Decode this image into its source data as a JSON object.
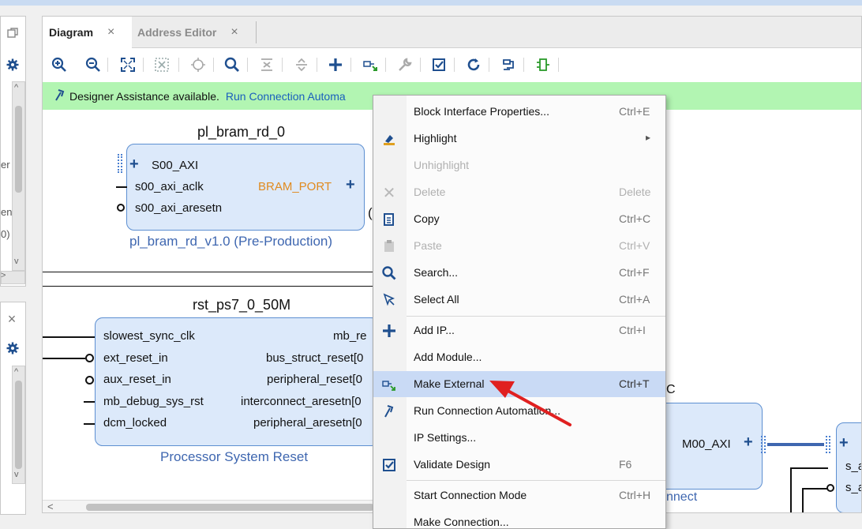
{
  "tabs": [
    {
      "label": "Diagram",
      "close": "×"
    },
    {
      "label": "Address Editor",
      "close": "×"
    }
  ],
  "toolbar": {
    "icons": [
      "zoom-in-icon",
      "zoom-out-icon",
      "zoom-fit-icon",
      "zoom-area-icon",
      "center-icon",
      "search-icon",
      "collapse-icon",
      "expand-icon",
      "add-icon",
      "make-external-icon",
      "properties-wrench-icon",
      "validate-icon",
      "refresh-icon",
      "regenerate-layout-icon",
      "pin-icon"
    ]
  },
  "assistance": {
    "text": "Designer Assistance available.",
    "link": "Run Connection Automa"
  },
  "left_panel": {
    "top_fragments": [
      "er",
      "en",
      "0)"
    ]
  },
  "blocks": {
    "pl_bram": {
      "title": "pl_bram_rd_0",
      "ports_left": [
        "S00_AXI",
        "s00_axi_aclk",
        "s00_axi_aresetn"
      ],
      "port_right": "BRAM_PORT",
      "subtitle": "pl_bram_rd_v1.0 (Pre-Production)",
      "frag": "("
    },
    "rst": {
      "title": "rst_ps7_0_50M",
      "ports_left": [
        "slowest_sync_clk",
        "ext_reset_in",
        "aux_reset_in",
        "mb_debug_sys_rst",
        "dcm_locked"
      ],
      "ports_right": [
        "mb_re",
        "bus_struct_reset[0",
        "peripheral_reset[0",
        "interconnect_aresetn[0",
        "peripheral_aresetn[0"
      ],
      "subtitle": "Processor System Reset"
    },
    "interconnect": {
      "port": "M00_AXI",
      "subtitle_frag": "nnect",
      "frag_c": "C"
    },
    "right_block": {
      "ports": [
        "s_a",
        "s_a"
      ]
    }
  },
  "context_menu": {
    "items": [
      {
        "label": "Block Interface Properties...",
        "shortcut": "Ctrl+E",
        "icon": "",
        "disabled": false
      },
      {
        "label": "Highlight",
        "shortcut": "▸",
        "icon": "highlight-icon",
        "disabled": false
      },
      {
        "label": "Unhighlight",
        "shortcut": "",
        "icon": "",
        "disabled": true
      },
      {
        "label": "Delete",
        "shortcut": "Delete",
        "icon": "delete-icon",
        "disabled": true
      },
      {
        "label": "Copy",
        "shortcut": "Ctrl+C",
        "icon": "copy-icon",
        "disabled": false
      },
      {
        "label": "Paste",
        "shortcut": "Ctrl+V",
        "icon": "paste-icon",
        "disabled": true
      },
      {
        "label": "Search...",
        "shortcut": "Ctrl+F",
        "icon": "search-icon",
        "disabled": false
      },
      {
        "label": "Select All",
        "shortcut": "Ctrl+A",
        "icon": "select-all-icon",
        "disabled": false
      },
      {
        "label": "Add IP...",
        "shortcut": "Ctrl+I",
        "icon": "add-icon",
        "disabled": false
      },
      {
        "label": "Add Module...",
        "shortcut": "",
        "icon": "",
        "disabled": false
      },
      {
        "label": "Make External",
        "shortcut": "Ctrl+T",
        "icon": "make-external-icon",
        "disabled": false,
        "highlighted": true
      },
      {
        "label": "Run Connection Automation...",
        "shortcut": "",
        "icon": "run-automation-icon",
        "disabled": false
      },
      {
        "label": "IP Settings...",
        "shortcut": "",
        "icon": "",
        "disabled": false
      },
      {
        "label": "Validate Design",
        "shortcut": "F6",
        "icon": "validate-icon",
        "disabled": false
      },
      {
        "label": "Start Connection Mode",
        "shortcut": "Ctrl+H",
        "icon": "",
        "disabled": false
      },
      {
        "label": "Make Connection...",
        "shortcut": "",
        "icon": "",
        "disabled": false
      }
    ]
  },
  "colors": {
    "accent": "#1a5fbd",
    "assist_bg": "#b2f5b2",
    "block_fill": "#dce9fa",
    "block_border": "#5d8fd1",
    "menu_highlight": "#c9daf5",
    "arrow": "#e02020",
    "port_orange": "#e08a1e"
  }
}
